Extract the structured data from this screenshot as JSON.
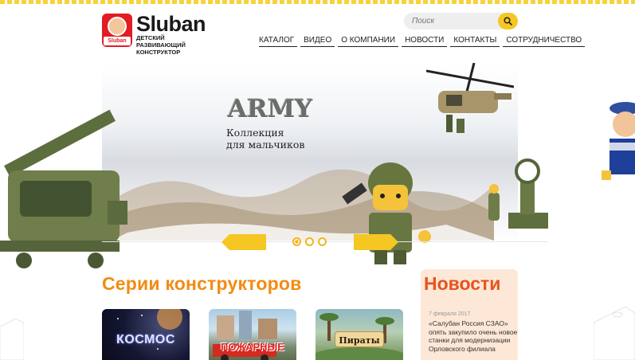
{
  "brand": {
    "name": "Sluban",
    "badge_text": "Sluban",
    "tagline": "ДЕТСКИЙ РАЗВИВАЮЩИЙ КОНСТРУКТОР"
  },
  "search": {
    "placeholder": "Поиск"
  },
  "nav": {
    "items": [
      {
        "label": "КАТАЛОГ"
      },
      {
        "label": "ВИДЕО"
      },
      {
        "label": "О КОМПАНИИ"
      },
      {
        "label": "НОВОСТИ"
      },
      {
        "label": "КОНТАКТЫ"
      },
      {
        "label": "СОТРУДНИЧЕСТВО"
      }
    ]
  },
  "banner": {
    "title": "ARMY",
    "subtitle_line1": "Коллекция",
    "subtitle_line2": "для мальчиков",
    "slides_total": 3,
    "active_slide": 1
  },
  "series": {
    "title": "Серии конструкторов",
    "cards": [
      {
        "label": "КОСМОС"
      },
      {
        "label": "ПОЖАРНЫЕ"
      },
      {
        "label": "Пираты"
      }
    ]
  },
  "news": {
    "title": "Новости",
    "items": [
      {
        "date": "7 февраля 2017",
        "text": "«Салубан Россия СЗАО» опять закупило очень новое станки для модернизации Орловского филиала"
      }
    ]
  },
  "colors": {
    "accent_yellow": "#f5c723",
    "section_orange": "#f28b11",
    "news_orange": "#e8531c",
    "brand_red": "#e21c24"
  }
}
